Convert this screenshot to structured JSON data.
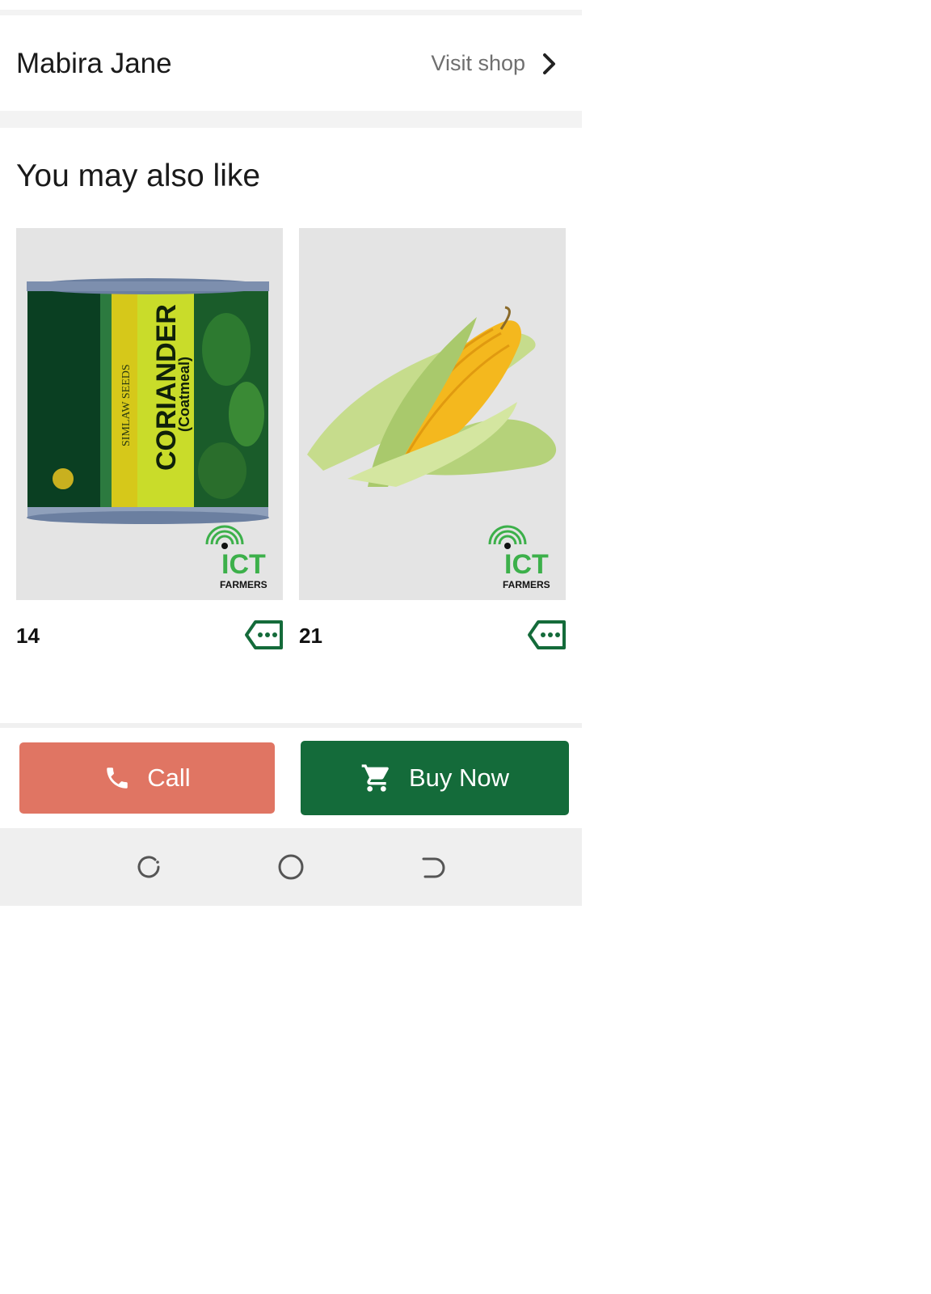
{
  "seller": {
    "name": "Mabira Jane",
    "visit_label": "Visit shop"
  },
  "recommendations": {
    "title": "You may also like",
    "items": [
      {
        "price": "14",
        "image_icon": "coriander-seed-can-image",
        "can_brand": "SIMLAW SEEDS",
        "can_name": "CORIANDER",
        "can_variety": "(Coatmeal)",
        "watermark": "ICT FARMERS"
      },
      {
        "price": "21",
        "image_icon": "maize-cobs-image",
        "watermark": "ICT FARMERS"
      }
    ]
  },
  "actions": {
    "call_label": "Call",
    "buy_label": "Buy Now"
  },
  "colors": {
    "call_button": "#e07563",
    "buy_button": "#146b3a",
    "tag_icon": "#146b3a"
  }
}
